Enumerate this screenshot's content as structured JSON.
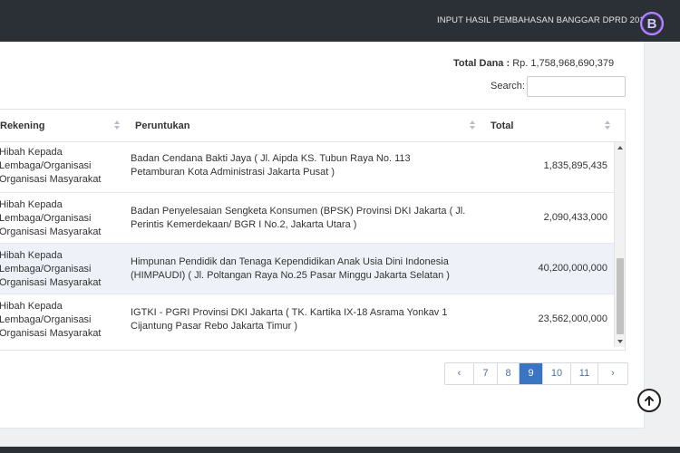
{
  "header": {
    "title": "INPUT HASIL PEMBAHASAN BANGGAR DPRD 2018",
    "logo_letter": "B"
  },
  "summary": {
    "total_label": "Total Dana :",
    "total_value": "Rp. 1,758,968,690,379"
  },
  "search": {
    "label": "Search:",
    "value": "",
    "placeholder": ""
  },
  "table": {
    "columns": [
      "Rekening",
      "Peruntukan",
      "Total"
    ],
    "rows": [
      {
        "rekening": "Hibah Kepada Lembaga/Organisasi Organisasi Masyarakat",
        "peruntukan": "Badan Cendana Bakti Jaya ( Jl. Aipda KS. Tubun Raya No. 113 Petamburan Kota Administrasi Jakarta Pusat )",
        "total": "1,835,895,435"
      },
      {
        "rekening": "Hibah Kepada Lembaga/Organisasi Organisasi Masyarakat",
        "peruntukan": "Badan Penyelesaian Sengketa Konsumen (BPSK) Provinsi DKI Jakarta ( Jl. Perintis Kemerdekaan/ BGR I No.2, Jakarta Utara )",
        "total": "2,090,433,000"
      },
      {
        "rekening": "Hibah Kepada Lembaga/Organisasi Organisasi Masyarakat",
        "peruntukan": "Himpunan Pendidik dan Tenaga Kependidikan Anak Usia Dini Indonesia (HIMPAUDI) ( Jl. Poltangan Raya No.25 Pasar Minggu Jakarta Selatan )",
        "total": "40,200,000,000"
      },
      {
        "rekening": "Hibah Kepada Lembaga/Organisasi Organisasi Masyarakat",
        "peruntukan": "IGTKI - PGRI Provinsi DKI Jakarta ( TK. Kartika IX-18 Asrama Yonkav 1 Cijantung Pasar Rebo Jakarta Timur )",
        "total": "23,562,000,000"
      }
    ]
  },
  "pagination": {
    "prev": "‹",
    "next": "›",
    "pages": [
      "7",
      "8",
      "9",
      "10",
      "11"
    ],
    "active": "9"
  },
  "icons": {
    "scroll_top": "arrow-up-circle-icon",
    "sort": "sort-icon"
  },
  "colors": {
    "topbar": "#2b2f36",
    "active_page": "#3a75c4",
    "row_alt": "#eef2f8"
  }
}
